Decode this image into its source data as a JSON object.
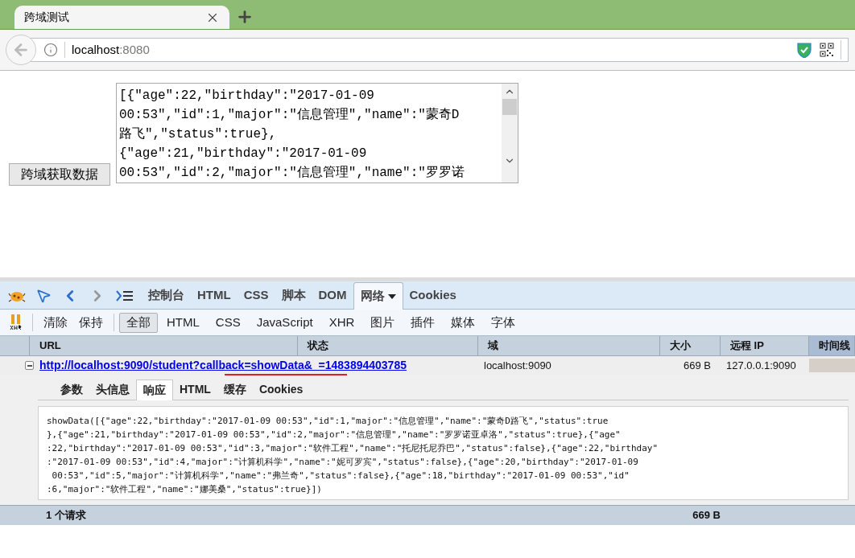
{
  "browser_tab": {
    "title": "跨域测试"
  },
  "address_bar": {
    "host": "localhost",
    "port": ":8080"
  },
  "page": {
    "button": "跨域获取数据",
    "textarea_lines": [
      "[{\"age\":22,\"birthday\":\"2017-01-09",
      "00:53\",\"id\":1,\"major\":\"信息管理\",\"name\":\"蒙奇D",
      "路飞\",\"status\":true},",
      "{\"age\":21,\"birthday\":\"2017-01-09",
      "00:53\",\"id\":2,\"major\":\"信息管理\",\"name\":\"罗罗诺"
    ]
  },
  "devtools": {
    "tabs": [
      {
        "label": "控制台",
        "selected": false,
        "has_menu": false
      },
      {
        "label": "HTML",
        "selected": false,
        "has_menu": false
      },
      {
        "label": "CSS",
        "selected": false,
        "has_menu": false
      },
      {
        "label": "脚本",
        "selected": false,
        "has_menu": false
      },
      {
        "label": "DOM",
        "selected": false,
        "has_menu": false
      },
      {
        "label": "网络",
        "selected": true,
        "has_menu": true
      },
      {
        "label": "Cookies",
        "selected": false,
        "has_menu": false
      }
    ],
    "actions": [
      "清除",
      "保持"
    ],
    "filters": [
      {
        "label": "全部",
        "selected": true
      },
      {
        "label": "HTML",
        "selected": false
      },
      {
        "label": "CSS",
        "selected": false
      },
      {
        "label": "JavaScript",
        "selected": false
      },
      {
        "label": "XHR",
        "selected": false
      },
      {
        "label": "图片",
        "selected": false
      },
      {
        "label": "插件",
        "selected": false
      },
      {
        "label": "媒体",
        "selected": false
      },
      {
        "label": "字体",
        "selected": false
      }
    ],
    "columns": [
      {
        "label": "URL",
        "selected": false
      },
      {
        "label": "状态",
        "selected": false
      },
      {
        "label": "域",
        "selected": false
      },
      {
        "label": "大小",
        "selected": false
      },
      {
        "label": "远程 IP",
        "selected": false
      },
      {
        "label": "时间线",
        "selected": true
      }
    ],
    "requests": [
      {
        "url": "http://localhost:9090/student?callback=showData&_=1483894403785",
        "domain": "localhost:9090",
        "size": "669 B",
        "remote_ip": "127.0.0.1:9090",
        "expanded": true
      }
    ],
    "detail_tabs": [
      {
        "label": "参数",
        "selected": false
      },
      {
        "label": "头信息",
        "selected": false
      },
      {
        "label": "响应",
        "selected": true
      },
      {
        "label": "HTML",
        "selected": false
      },
      {
        "label": "缓存",
        "selected": false
      },
      {
        "label": "Cookies",
        "selected": false
      }
    ],
    "response_lines": [
      "showData([{\"age\":22,\"birthday\":\"2017-01-09 00:53\",\"id\":1,\"major\":\"信息管理\",\"name\":\"蒙奇D路飞\",\"status\":true",
      "},{\"age\":21,\"birthday\":\"2017-01-09 00:53\",\"id\":2,\"major\":\"信息管理\",\"name\":\"罗罗诺亚卓洛\",\"status\":true},{\"age\"",
      ":22,\"birthday\":\"2017-01-09 00:53\",\"id\":3,\"major\":\"软件工程\",\"name\":\"托尼托尼乔巴\",\"status\":false},{\"age\":22,\"birthday\"",
      ":\"2017-01-09 00:53\",\"id\":4,\"major\":\"计算机科学\",\"name\":\"妮可罗宾\",\"status\":false},{\"age\":20,\"birthday\":\"2017-01-09",
      " 00:53\",\"id\":5,\"major\":\"计算机科学\",\"name\":\"弗兰奇\",\"status\":false},{\"age\":18,\"birthday\":\"2017-01-09 00:53\",\"id\"",
      ":6,\"major\":\"软件工程\",\"name\":\"娜美桑\",\"status\":true}])"
    ],
    "summary": {
      "count": "1 个请求",
      "size": "669 B"
    }
  }
}
